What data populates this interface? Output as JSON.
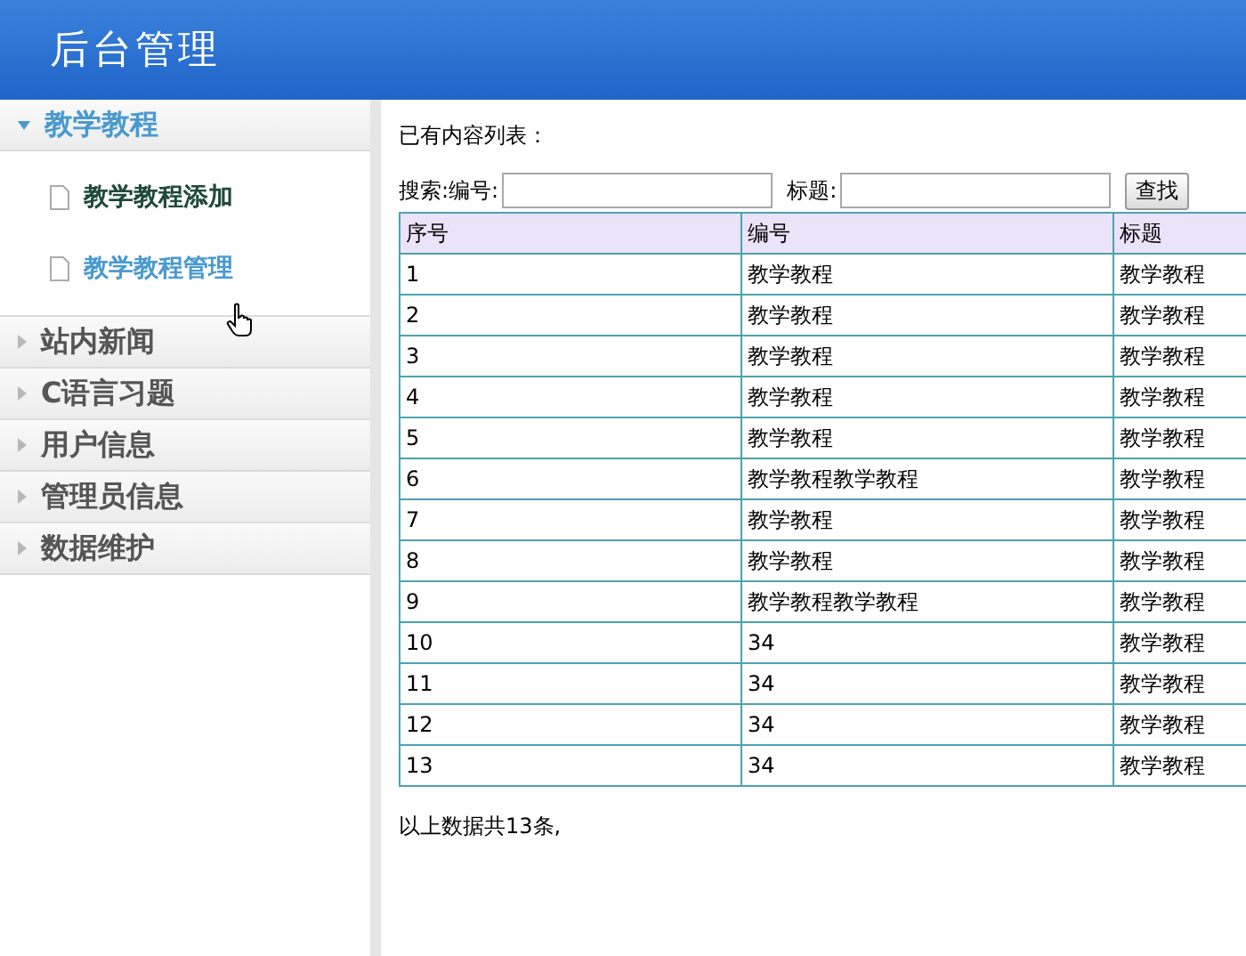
{
  "header": {
    "title": "后台管理"
  },
  "sidebar": {
    "sections": [
      {
        "label": "教学教程",
        "expanded": true,
        "children": [
          {
            "label": "教学教程添加",
            "selected": false
          },
          {
            "label": "教学教程管理",
            "selected": true
          }
        ]
      },
      {
        "label": "站内新闻",
        "expanded": false
      },
      {
        "label": "C语言习题",
        "expanded": false
      },
      {
        "label": "用户信息",
        "expanded": false
      },
      {
        "label": "管理员信息",
        "expanded": false
      },
      {
        "label": "数据维护",
        "expanded": false
      }
    ]
  },
  "main": {
    "heading": "已有内容列表：",
    "search": {
      "label_code": "搜索:编号:",
      "label_title": "标题:",
      "button": "查找"
    },
    "table": {
      "columns": [
        "序号",
        "编号",
        "标题"
      ],
      "rows": [
        [
          "1",
          "教学教程",
          "教学教程"
        ],
        [
          "2",
          "教学教程",
          "教学教程"
        ],
        [
          "3",
          "教学教程",
          "教学教程"
        ],
        [
          "4",
          "教学教程",
          "教学教程"
        ],
        [
          "5",
          "教学教程",
          "教学教程"
        ],
        [
          "6",
          "教学教程教学教程",
          "教学教程"
        ],
        [
          "7",
          "教学教程",
          "教学教程"
        ],
        [
          "8",
          "教学教程",
          "教学教程"
        ],
        [
          "9",
          "教学教程教学教程",
          "教学教程"
        ],
        [
          "10",
          "34",
          "教学教程"
        ],
        [
          "11",
          "34",
          "教学教程"
        ],
        [
          "12",
          "34",
          "教学教程"
        ],
        [
          "13",
          "34",
          "教学教程"
        ]
      ]
    },
    "footer": "以上数据共13条,"
  }
}
